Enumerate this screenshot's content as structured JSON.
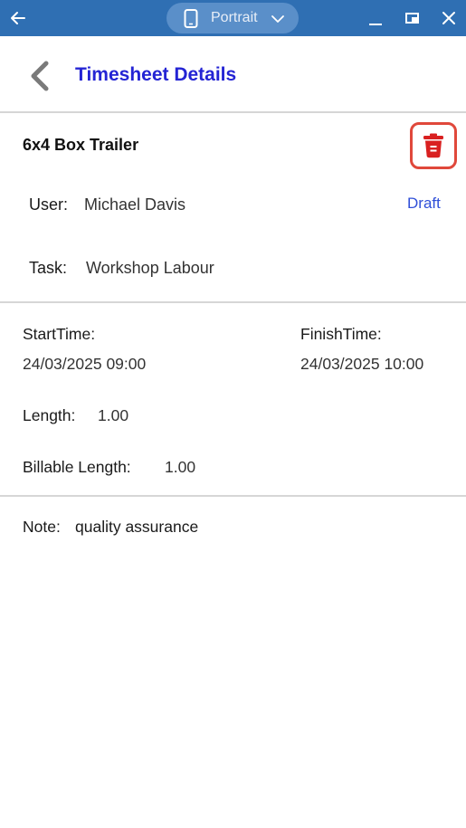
{
  "chrome": {
    "orientation_label": "Portrait",
    "bar_color": "#2f6fb3"
  },
  "header": {
    "title": "Timesheet Details"
  },
  "timesheet": {
    "item_name": "6x4 Box Trailer",
    "user_label": "User:",
    "user_value": "Michael Davis",
    "status": "Draft",
    "task_label": "Task:",
    "task_value": "Workshop Labour",
    "start_label": "StartTime:",
    "start_value": "24/03/2025 09:00",
    "finish_label": "FinishTime:",
    "finish_value": "24/03/2025 10:00",
    "length_label": "Length:",
    "length_value": "1.00",
    "billable_label": "Billable Length:",
    "billable_value": "1.00",
    "note_label": "Note:",
    "note_value": "quality assurance"
  },
  "colors": {
    "title": "#2424d4",
    "status": "#2f4fd8",
    "delete": "#d92020"
  }
}
